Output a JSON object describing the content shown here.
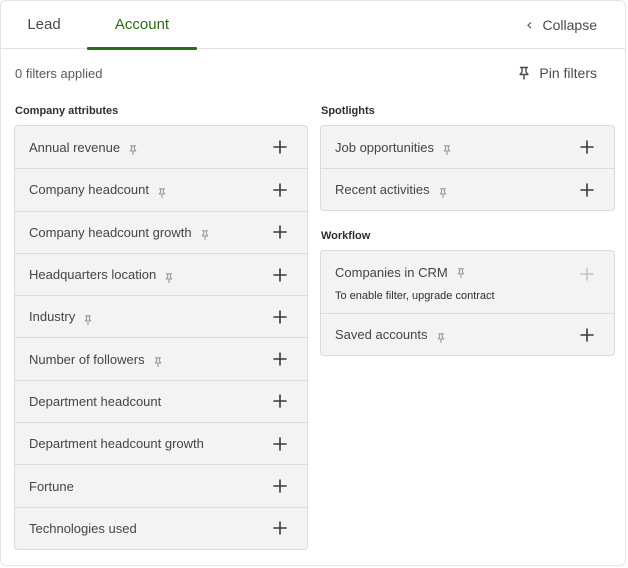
{
  "tabs": [
    {
      "label": "Lead",
      "active": false
    },
    {
      "label": "Account",
      "active": true
    }
  ],
  "header": {
    "collapse_label": "Collapse",
    "filters_applied": "0 filters applied",
    "pin_filters_label": "Pin filters"
  },
  "colors": {
    "accent": "#2b6b1b",
    "row_bg": "#f3f3f4",
    "border": "#dcdcdc"
  },
  "company_attributes": {
    "title": "Company attributes",
    "items": [
      {
        "label": "Annual revenue",
        "pinned_icon": true
      },
      {
        "label": "Company headcount",
        "pinned_icon": true
      },
      {
        "label": "Company headcount growth",
        "pinned_icon": true
      },
      {
        "label": "Headquarters location",
        "pinned_icon": true
      },
      {
        "label": "Industry",
        "pinned_icon": true
      },
      {
        "label": "Number of followers",
        "pinned_icon": true
      },
      {
        "label": "Department headcount",
        "pinned_icon": false
      },
      {
        "label": "Department headcount growth",
        "pinned_icon": false
      },
      {
        "label": "Fortune",
        "pinned_icon": false
      },
      {
        "label": "Technologies used",
        "pinned_icon": false
      }
    ]
  },
  "spotlights": {
    "title": "Spotlights",
    "items": [
      {
        "label": "Job opportunities",
        "pinned_icon": true
      },
      {
        "label": "Recent activities",
        "pinned_icon": true
      }
    ]
  },
  "workflow": {
    "title": "Workflow",
    "items": [
      {
        "label": "Companies in CRM",
        "pinned_icon": true,
        "disabled": true,
        "note": "To enable filter, upgrade contract"
      },
      {
        "label": "Saved accounts",
        "pinned_icon": true,
        "disabled": false
      }
    ]
  },
  "icons": {
    "pin": "pin-icon",
    "add": "plus-icon",
    "collapse": "chevron-left-icon"
  }
}
